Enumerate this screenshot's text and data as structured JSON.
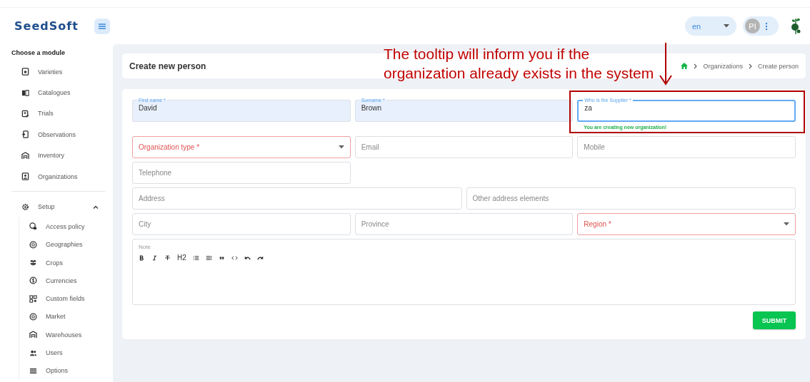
{
  "header": {
    "logo": "SeedSoft",
    "language": "en",
    "avatar": "PI"
  },
  "sidebar": {
    "heading": "Choose a module",
    "items": [
      {
        "label": "Varieties"
      },
      {
        "label": "Catalogues"
      },
      {
        "label": "Trials"
      },
      {
        "label": "Observations"
      },
      {
        "label": "Inventory"
      },
      {
        "label": "Organizations"
      }
    ],
    "setup": {
      "label": "Setup",
      "expanded": true,
      "children": [
        {
          "label": "Access policy"
        },
        {
          "label": "Geographies"
        },
        {
          "label": "Crops"
        },
        {
          "label": "Currencies"
        },
        {
          "label": "Custom fields"
        },
        {
          "label": "Market"
        },
        {
          "label": "Warehouses"
        },
        {
          "label": "Users"
        },
        {
          "label": "Options"
        }
      ]
    }
  },
  "page": {
    "title": "Create new person",
    "breadcrumb": [
      "Organizations",
      "Create person"
    ]
  },
  "form": {
    "rows": [
      [
        {
          "kind": "input",
          "label": "First name *",
          "value": "David",
          "autofilled": true,
          "focused": false,
          "invalid": false
        },
        {
          "kind": "input",
          "label": "Surname *",
          "value": "Brown",
          "autofilled": true,
          "focused": false,
          "invalid": false
        },
        {
          "kind": "input",
          "label": "Who is the Supplier *",
          "value": "za",
          "autofilled": false,
          "focused": true,
          "invalid": false,
          "helper": "You are creating new organization!"
        }
      ],
      [
        {
          "kind": "select",
          "placeholder": "Organization type *",
          "autofilled": false,
          "focused": false,
          "invalid": true
        },
        {
          "kind": "input",
          "placeholder": "Email",
          "autofilled": false,
          "focused": false,
          "invalid": false
        },
        {
          "kind": "input",
          "placeholder": "Mobile",
          "autofilled": false,
          "focused": false,
          "invalid": false
        }
      ],
      [
        {
          "kind": "input",
          "placeholder": "Telephone",
          "autofilled": false,
          "focused": false,
          "invalid": false
        }
      ],
      [
        {
          "kind": "input",
          "placeholder": "Address",
          "autofilled": false,
          "focused": false,
          "invalid": false
        },
        {
          "kind": "input",
          "placeholder": "Other address elements",
          "autofilled": false,
          "focused": false,
          "invalid": false
        }
      ],
      [
        {
          "kind": "input",
          "placeholder": "City",
          "autofilled": false,
          "focused": false,
          "invalid": false
        },
        {
          "kind": "input",
          "placeholder": "Province",
          "autofilled": false,
          "focused": false,
          "invalid": false
        },
        {
          "kind": "select",
          "placeholder": "Region *",
          "autofilled": false,
          "focused": false,
          "invalid": true
        }
      ]
    ],
    "note": {
      "label": "Note",
      "toolbar": [
        {
          "kind": "bold"
        },
        {
          "kind": "italic"
        },
        {
          "kind": "strike"
        },
        {
          "kind": "heading",
          "label": "H2"
        },
        {
          "kind": "bullet-list"
        },
        {
          "kind": "ordered-list"
        },
        {
          "kind": "quote"
        },
        {
          "kind": "code"
        },
        {
          "kind": "undo"
        },
        {
          "kind": "redo"
        }
      ]
    },
    "submit": "SUBMIT"
  },
  "annotation": {
    "text": "The tooltip will inform you if the organization already exists in the system"
  }
}
